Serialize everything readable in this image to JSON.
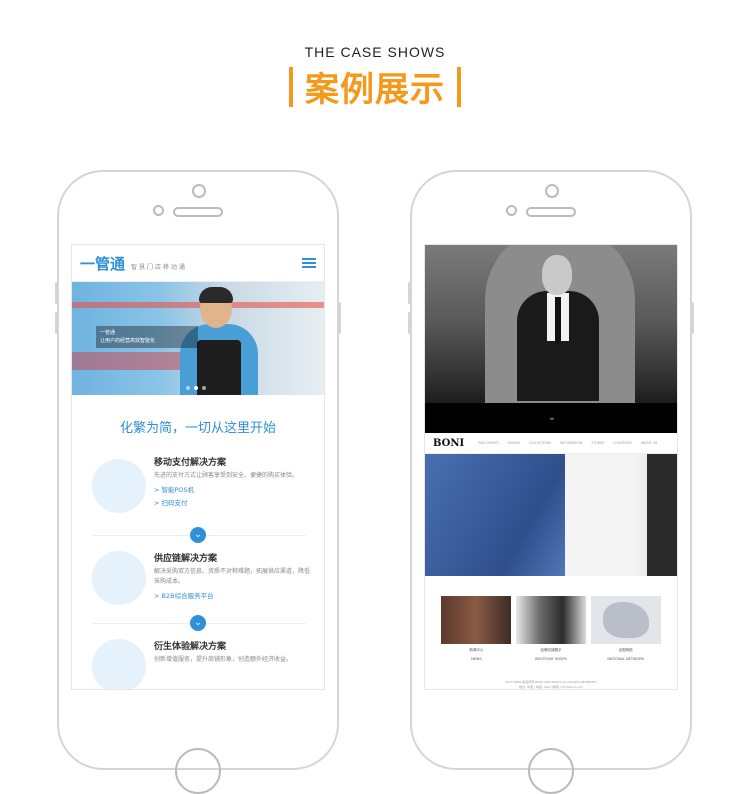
{
  "header": {
    "subtitle_en": "THE CASE SHOWS",
    "title_cn": "案例展示"
  },
  "phone1": {
    "logo_text": "一管通",
    "logo_slogan": "智慧门店移动通",
    "hero_caption_1": "一管通",
    "hero_caption_2": "让用户的经营高效智能化",
    "slogan": "化繁为简，一切从这里开始",
    "services": [
      {
        "title": "移动支付解决方案",
        "desc": "先进的支付方式让顾客享受到安全、便捷的购买体验。",
        "links": [
          "> 智能POS机",
          "> 扫码支付"
        ]
      },
      {
        "title": "供应链解决方案",
        "desc": "解决采购双方信息、资质不对称难题，拓展供应渠道，降低采购成本。",
        "links": [
          "> B2B综合服务平台"
        ]
      },
      {
        "title": "衍生体验解决方案",
        "desc": "创新增值服务，提升商铺形象，创造额外经济收益。",
        "links": []
      }
    ],
    "chevron": "⌄"
  },
  "phone2": {
    "brand": "BONI",
    "nav_items": [
      "PHILOSOPHY",
      "DESIGN",
      "COLLECTIONS",
      "INFORMATION",
      "STORES",
      "COUNTRIES",
      "ABOUT US"
    ],
    "hero_chevron": "⌄",
    "thumbs": [
      {
        "cap1": "新闻中心",
        "cap2": "NEWS"
      },
      {
        "cap1": "品牌店铺展示",
        "cap2": "BOUTIQUE SHOPS"
      },
      {
        "cap1": "全国网络",
        "cap2": "NATIONAL NETWORK"
      }
    ],
    "footer_1": "2015 BONI 版权所有 BONI COPYRIGHT ALL RIGHTS RESERVED",
    "footer_2": "地址: 中国 | 电话: 400 | 邮箱: info@boni.com"
  },
  "colors": {
    "accent_orange": "#f39a1d",
    "brand_blue": "#2f8fd8"
  }
}
